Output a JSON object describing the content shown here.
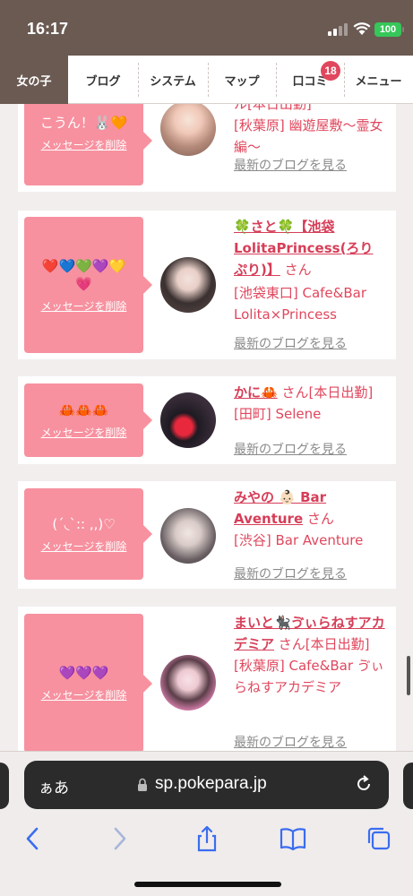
{
  "status": {
    "time": "16:17",
    "battery": "100"
  },
  "nav": {
    "tabs": [
      {
        "label": "女の子",
        "active": true
      },
      {
        "label": "ブログ"
      },
      {
        "label": "システム"
      },
      {
        "label": "マップ"
      },
      {
        "label": "口コミ",
        "badge": "18"
      },
      {
        "label": "メニュー"
      }
    ]
  },
  "cards": [
    {
      "emoji": "こうん！🐰🧡",
      "delete_label": "メッセージを削除",
      "name": "",
      "san": "",
      "extra": "ル[本日出勤]",
      "place": "[秋葉原] 幽遊屋敷～霊女編～",
      "blog_label": "最新のブログを見る"
    },
    {
      "emoji": "❤️💙💚💜💛💗",
      "delete_label": "メッセージを削除",
      "name": "🍀さと🍀【池袋LolitaPrincess(ろりぷり)】",
      "san": "さん",
      "extra": "",
      "place": "[池袋東口] Cafe&Bar Lolita×Princess",
      "blog_label": "最新のブログを見る"
    },
    {
      "emoji": "🦀🦀🦀",
      "delete_label": "メッセージを削除",
      "name": "かに🦀",
      "san": "さん[本日出勤]",
      "extra": "",
      "place": "[田町] Selene",
      "blog_label": "最新のブログを見る"
    },
    {
      "emoji": "(ˊ◟ˋ:: ,,)♡",
      "delete_label": "メッセージを削除",
      "name": "みやの 👶🏻 Bar Aventure",
      "san": "さん",
      "extra": "",
      "place": "[渋谷] Bar Aventure",
      "blog_label": "最新のブログを見る"
    },
    {
      "emoji": "💜💜💜",
      "delete_label": "メッセージを削除",
      "name": "まいと🐈‍⬛ゔぃらねすアカデミア",
      "san": "さん[本日出勤]",
      "extra": "",
      "place": "[秋葉原] Cafe&Bar ゔぃらねすアカデミア",
      "blog_label": "最新のブログを見る"
    }
  ],
  "safari": {
    "aa": "ぁあ",
    "url": "sp.pokepara.jp"
  }
}
